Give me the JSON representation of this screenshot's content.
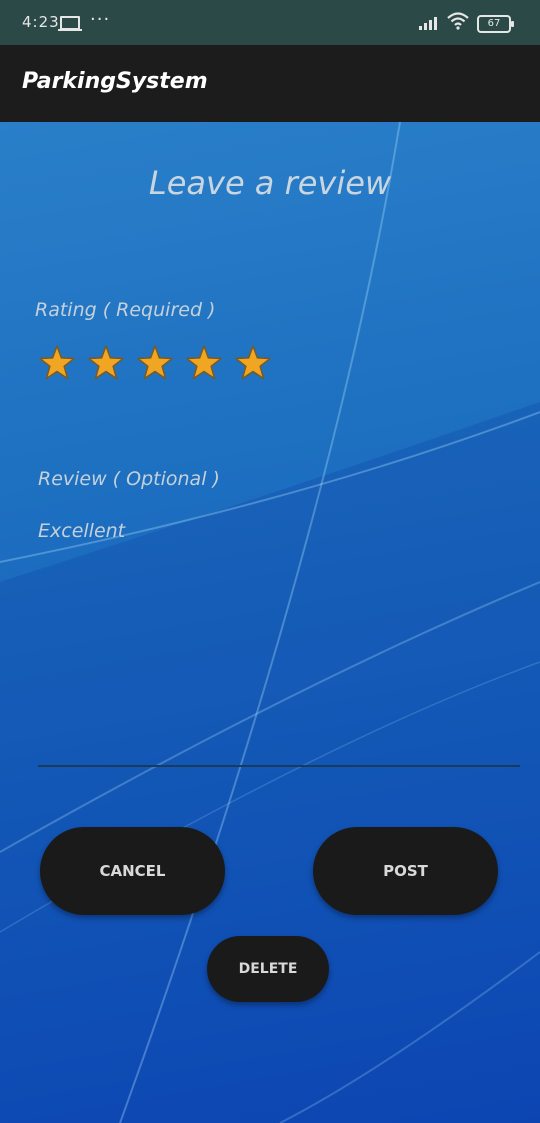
{
  "status_bar": {
    "time": "4:23",
    "dots": "···",
    "battery": "67"
  },
  "app_bar": {
    "title": "ParkingSystem"
  },
  "page": {
    "heading": "Leave a review",
    "rating_label": "Rating ( Required )",
    "rating_value": 5,
    "rating_max": 5,
    "review_label": "Review ( Optional )",
    "review_text": "Excellent"
  },
  "buttons": {
    "cancel": "CANCEL",
    "post": "POST",
    "delete": "DELETE"
  },
  "colors": {
    "star_fill": "#f0a523",
    "button_bg": "#1a1a1a",
    "app_bar_bg": "#1c1c1c",
    "status_bar_bg": "#2b4a47"
  }
}
